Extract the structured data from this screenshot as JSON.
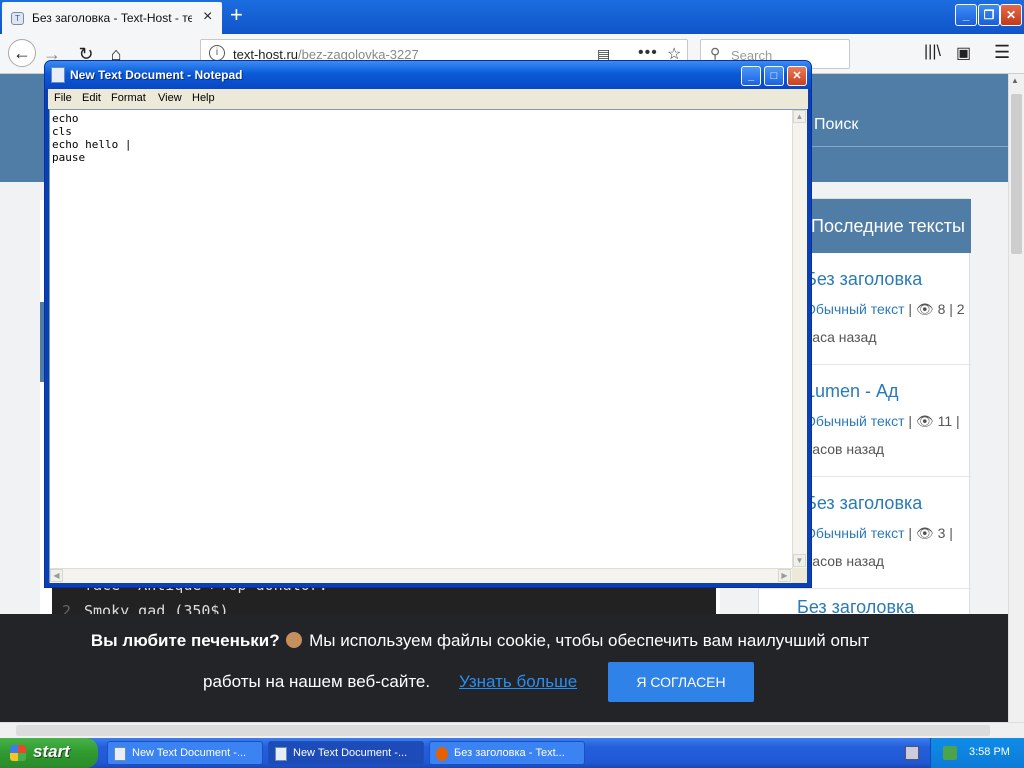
{
  "browser": {
    "tab_title": "Без заголовка - Text-Host - текс",
    "tab_favicon_glyph": "T",
    "url_host": "text-host.ru",
    "url_path": "/bez-zagolovka-3227",
    "search_placeholder": "Search"
  },
  "page": {
    "header_search_link": "Поиск",
    "code_line1": "face=\"Antique\">Top donator:",
    "code_line2_num": "2",
    "code_line2": "Smoky_gad (350$)",
    "sidebar": {
      "header": "Последние тексты",
      "items": [
        {
          "title": "Без заголовка",
          "meta_link": "Обычный текст",
          "meta_counts": "| 👁 8 | 2",
          "time": "часа назад"
        },
        {
          "title": "Lumen - Ад",
          "meta_link": "Обычный текст",
          "meta_counts": "| 👁 11 |",
          "time": "часов назад"
        },
        {
          "title": "Без заголовка",
          "meta_link": "Обычный текст",
          "meta_counts": "| 👁 3 |",
          "time": "часов назад"
        }
      ],
      "last_item_title": "Без заголовка"
    }
  },
  "notepad": {
    "title": "New Text Document - Notepad",
    "menu": [
      "File",
      "Edit",
      "Format",
      "View",
      "Help"
    ],
    "content": "echo\ncls\necho hello |\npause"
  },
  "cookie": {
    "bold": "Вы любите печеньки?",
    "line1_rest": " Мы используем файлы cookie, чтобы обеспечить вам наилучший опыт",
    "line2": "работы на нашем веб-сайте.",
    "link": "Узнать больше",
    "button": "Я СОГЛАСЕН"
  },
  "taskbar": {
    "start_label": "start",
    "tasks": [
      "New Text Document -...",
      "New Text Document -...",
      "Без заголовка - Text..."
    ],
    "clock": "3:58 PM"
  },
  "colors": {
    "page_header": "#4f7da6",
    "link": "#2a7ab8",
    "cookie_button": "#2f83e8",
    "xp_title": "#0b5bd8"
  }
}
